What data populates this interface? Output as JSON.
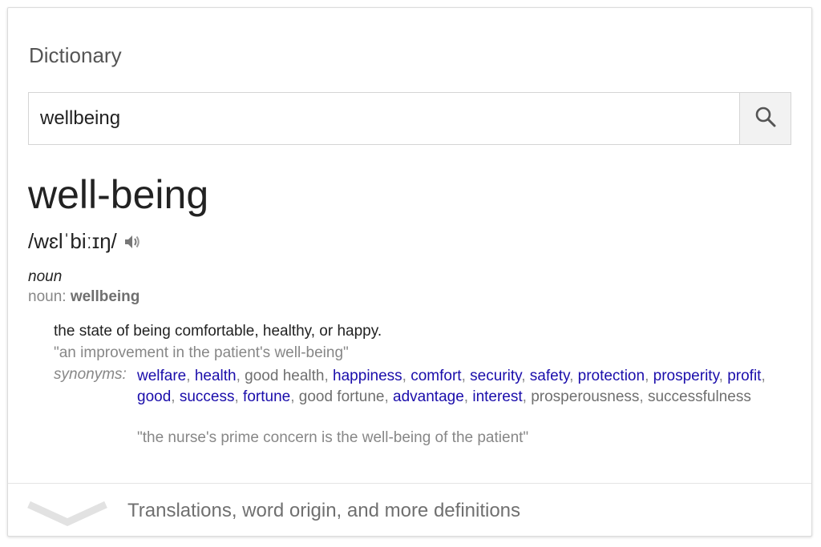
{
  "card": {
    "title": "Dictionary"
  },
  "search": {
    "value": "wellbeing",
    "icon": "search-icon"
  },
  "entry": {
    "headword": "well-being",
    "phonetic": "/wɛlˈbiːɪŋ/",
    "audio_icon": "speaker-icon",
    "part_of_speech": "noun",
    "variant_label": "noun:",
    "variant_word": "wellbeing",
    "definition": "the state of being comfortable, healthy, or happy.",
    "example": "\"an improvement in the patient's well-being\"",
    "synonyms_label": "synonyms:",
    "synonyms": [
      {
        "text": "welfare",
        "link": true
      },
      {
        "text": "health",
        "link": true
      },
      {
        "text": "good health",
        "link": false
      },
      {
        "text": "happiness",
        "link": true
      },
      {
        "text": "comfort",
        "link": true
      },
      {
        "text": "security",
        "link": true
      },
      {
        "text": "safety",
        "link": true
      },
      {
        "text": "protection",
        "link": true
      },
      {
        "text": "prosperity",
        "link": true
      },
      {
        "text": "profit",
        "link": true
      },
      {
        "text": "good",
        "link": true
      },
      {
        "text": "success",
        "link": true
      },
      {
        "text": "fortune",
        "link": true
      },
      {
        "text": "good fortune",
        "link": false
      },
      {
        "text": "advantage",
        "link": true
      },
      {
        "text": "interest",
        "link": true
      },
      {
        "text": "prosperousness",
        "link": false
      },
      {
        "text": "successfulness",
        "link": false
      }
    ],
    "synonym_example": "\"the nurse's prime concern is the well-being of the patient\""
  },
  "footer": {
    "more_label": "Translations, word origin, and more definitions",
    "icon": "chevron-down-icon"
  },
  "colors": {
    "link": "#1a0dab",
    "muted": "#878787"
  }
}
